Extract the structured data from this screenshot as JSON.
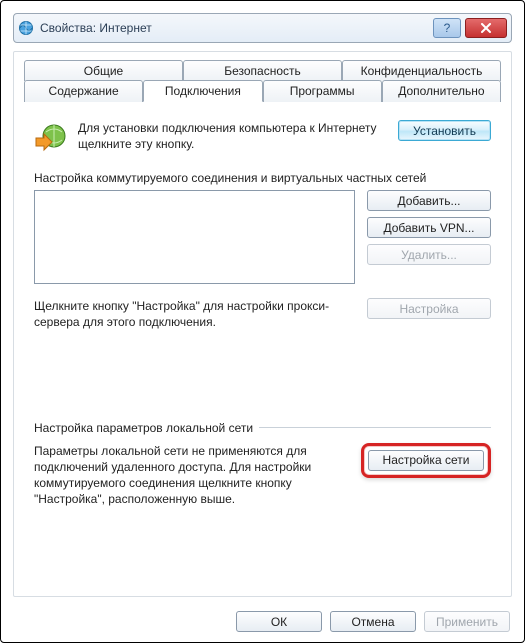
{
  "window": {
    "title": "Свойства: Интернет"
  },
  "tabs": {
    "row1": [
      "Общие",
      "Безопасность",
      "Конфиденциальность"
    ],
    "row2": [
      "Содержание",
      "Подключения",
      "Программы",
      "Дополнительно"
    ],
    "active": "Подключения"
  },
  "setup": {
    "text": "Для установки подключения компьютера к Интернету щелкните эту кнопку.",
    "button": "Установить"
  },
  "dialup": {
    "label": "Настройка коммутируемого соединения и виртуальных частных сетей",
    "buttons": {
      "add": "Добавить...",
      "add_vpn": "Добавить VPN...",
      "remove": "Удалить..."
    },
    "hint": "Щелкните кнопку \"Настройка\" для настройки прокси-сервера для этого подключения.",
    "settings_btn": "Настройка"
  },
  "lan": {
    "header": "Настройка параметров локальной сети",
    "text": "Параметры локальной сети не применяются для подключений удаленного доступа. Для настройки коммутируемого соединения щелкните кнопку \"Настройка\", расположенную выше.",
    "button": "Настройка сети"
  },
  "footer": {
    "ok": "ОК",
    "cancel": "Отмена",
    "apply": "Применить"
  }
}
